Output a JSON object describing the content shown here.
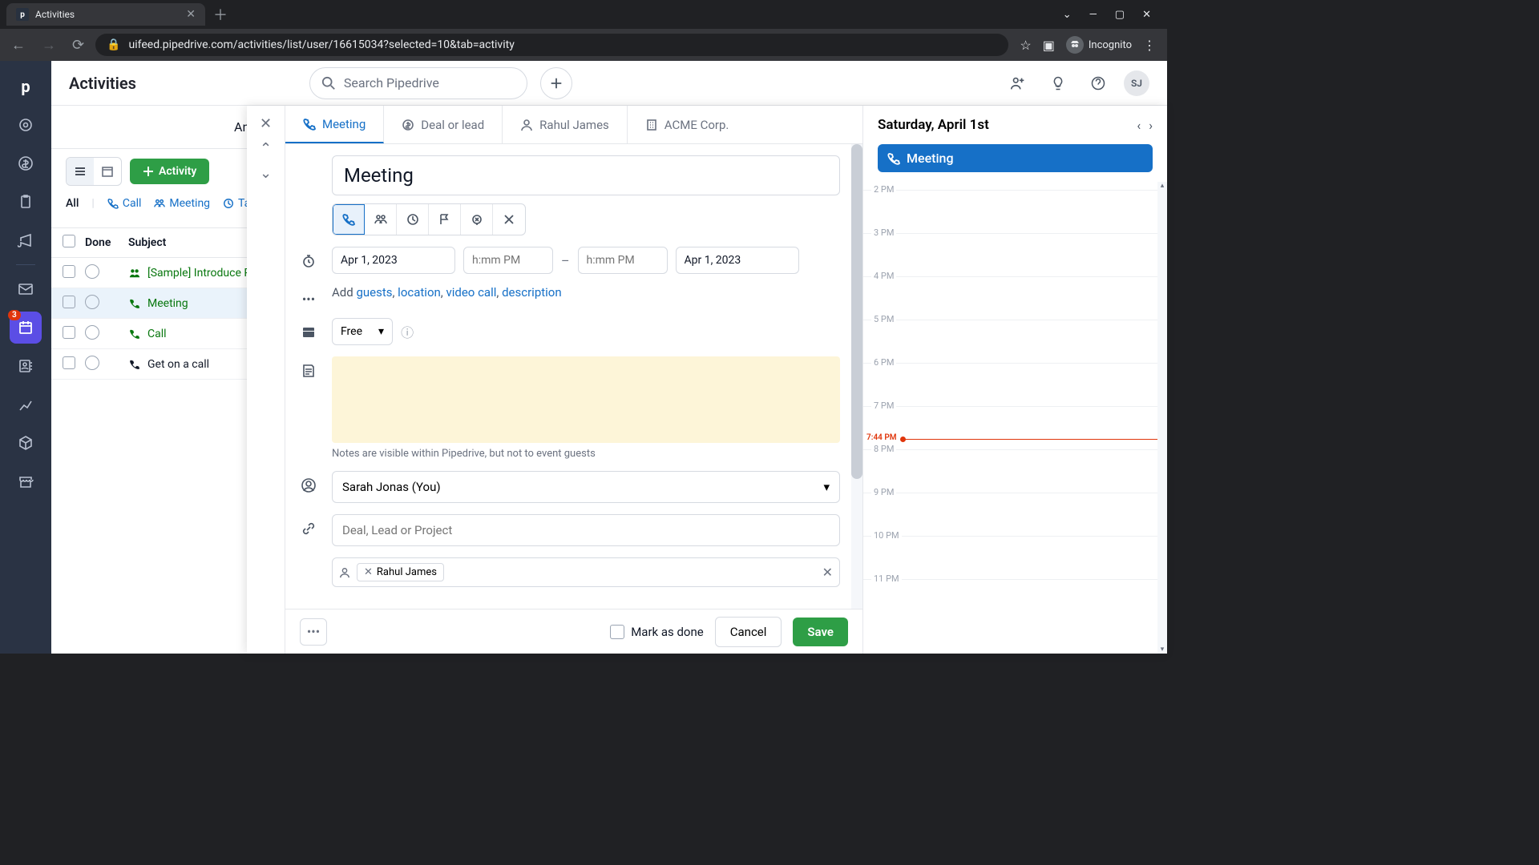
{
  "browser": {
    "tab_title": "Activities",
    "url": "uifeed.pipedrive.com/activities/list/user/16615034?selected=10&tab=activity",
    "incognito_label": "Incognito"
  },
  "sidebar": {
    "badge": "3"
  },
  "header": {
    "title": "Activities",
    "search_placeholder": "Search Pipedrive",
    "avatar_initials": "SJ"
  },
  "toolbar": {
    "activity_label": "Activity"
  },
  "filter_tabs": {
    "all": "All",
    "call": "Call",
    "meeting": "Meeting",
    "task": "Task"
  },
  "table": {
    "head_done": "Done",
    "head_subject": "Subject",
    "rows": [
      {
        "subject": "[Sample] Introduce P…",
        "type": "meeting"
      },
      {
        "subject": "Meeting",
        "type": "call"
      },
      {
        "subject": "Call",
        "type": "call"
      },
      {
        "subject": "Get on a call",
        "type": "call-dark"
      }
    ]
  },
  "modal": {
    "tabs": {
      "meeting": "Meeting",
      "deal": "Deal or lead",
      "person": "Rahul James",
      "org": "ACME Corp."
    },
    "title_value": "Meeting",
    "date_start": "Apr 1, 2023",
    "time_placeholder": "h:mm PM",
    "date_end": "Apr 1, 2023",
    "add_prefix": "Add ",
    "add_guests": "guests",
    "add_location": "location",
    "add_video": "video call",
    "add_desc": "description",
    "availability": "Free",
    "notes_hint": "Notes are visible within Pipedrive, but not to event guests",
    "owner": "Sarah Jonas (You)",
    "link_placeholder": "Deal, Lead or Project",
    "person_chip": "Rahul James",
    "footer": {
      "mark_done": "Mark as done",
      "cancel": "Cancel",
      "save": "Save"
    }
  },
  "calendar": {
    "date_label": "Saturday, April 1st",
    "event_title": "Meeting",
    "now_label": "7:44 PM",
    "hours": [
      "2 PM",
      "3 PM",
      "4 PM",
      "5 PM",
      "6 PM",
      "7 PM",
      "8 PM",
      "9 PM",
      "10 PM",
      "11 PM"
    ]
  }
}
